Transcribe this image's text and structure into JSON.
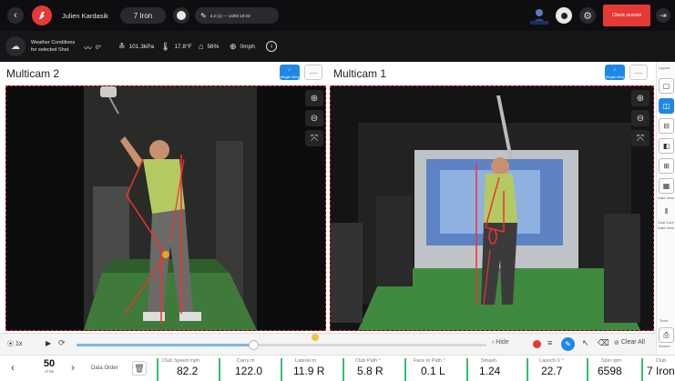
{
  "header": {
    "player_name": "Julien Kardasik",
    "club_pill": "7 Iron",
    "session_text": "4.2 (1) — 14/03 10:23",
    "end_session_label": "Check session",
    "brand_color": "#e53935"
  },
  "conditions": {
    "title": "Weather Conditions",
    "subtitle": "for selected Shot",
    "items": [
      {
        "icon": "wind-icon",
        "value": "0°"
      },
      {
        "icon": "pressure-icon",
        "value": "101.3kPa"
      },
      {
        "icon": "temperature-icon",
        "value": "17.8°F"
      },
      {
        "icon": "humidity-icon",
        "value": "56%"
      },
      {
        "icon": "wind-speed-icon",
        "value": "0mph"
      }
    ]
  },
  "panels": [
    {
      "title": "Multicam 2",
      "view_label": "Single View",
      "more_label": "···"
    },
    {
      "title": "Multicam 1",
      "view_label": "Single View",
      "more_label": "···"
    }
  ],
  "layouts": {
    "title": "Layout",
    "items": [
      "single",
      "side-by-side",
      "stacked",
      "left-main",
      "grid-2x2",
      "four-grid"
    ],
    "selected_index": 1,
    "bottom_labels": [
      "Data View",
      "Dual Cam",
      "Data View"
    ],
    "tools_label": "Tools",
    "tools_button": "Screen"
  },
  "timeline": {
    "speed_label": "1x",
    "progress": 0.43,
    "hide_label": "Hide",
    "clear_all_label": "Clear All"
  },
  "shots": {
    "current": "50",
    "of_label": "of 95",
    "data_order_label": "Data Order"
  },
  "metrics": [
    {
      "label": "Club Speed mph",
      "value": "82.2"
    },
    {
      "label": "Carry m",
      "value": "122.0"
    },
    {
      "label": "Lateral m",
      "value": "11.9 R"
    },
    {
      "label": "Club Path °",
      "value": "5.8 R"
    },
    {
      "label": "Face to Path °",
      "value": "0.1 L"
    },
    {
      "label": "Smash",
      "value": "1.24"
    },
    {
      "label": "Launch V °",
      "value": "22.7"
    },
    {
      "label": "Spin rpm",
      "value": "6598"
    },
    {
      "label": "Club",
      "value": "7 Iron"
    }
  ]
}
